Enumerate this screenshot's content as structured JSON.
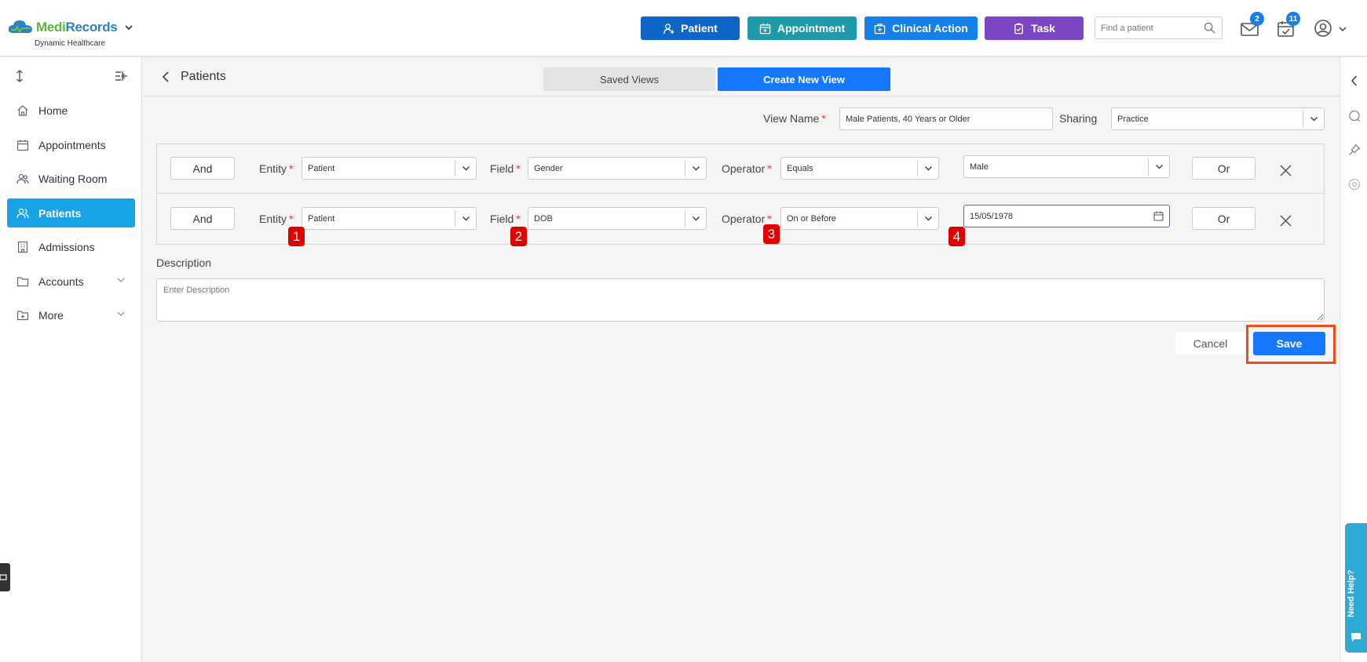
{
  "brand": {
    "name_part1": "Medi",
    "name_part2": "Records",
    "subtitle": "Dynamic Healthcare"
  },
  "header": {
    "buttons": [
      {
        "label": "Patient",
        "color": "#0e65c8"
      },
      {
        "label": "Appointment",
        "color": "#1e9aaa"
      },
      {
        "label": "Clinical Action",
        "color": "#1480e8"
      },
      {
        "label": "Task",
        "color": "#7b45c4"
      }
    ],
    "search_placeholder": "Find a patient",
    "mail_badge": "2",
    "calendar_badge": "11"
  },
  "sidebar": {
    "items": [
      {
        "label": "Home",
        "icon": "home-icon"
      },
      {
        "label": "Appointments",
        "icon": "calendar-icon"
      },
      {
        "label": "Waiting Room",
        "icon": "people-icon"
      },
      {
        "label": "Patients",
        "icon": "patients-icon",
        "active": true
      },
      {
        "label": "Admissions",
        "icon": "building-icon"
      },
      {
        "label": "Accounts",
        "icon": "folder-icon"
      },
      {
        "label": "More",
        "icon": "folder-add-icon"
      }
    ]
  },
  "page": {
    "breadcrumb": "Patients",
    "tabs": [
      "Saved Views",
      "Create New View"
    ]
  },
  "form": {
    "view_name_label": "View Name",
    "view_name_value": "Male Patients, 40 Years or Older",
    "sharing_label": "Sharing",
    "sharing_value": "Practice",
    "labels": {
      "entity": "Entity",
      "field": "Field",
      "operator": "Operator",
      "and": "And",
      "or": "Or"
    },
    "filters": [
      {
        "entity": "Patient",
        "field": "Gender",
        "operator": "Equals",
        "value": "Male"
      },
      {
        "entity": "Patient",
        "field": "DOB",
        "operator": "On or Before",
        "value": "15/05/1978"
      }
    ],
    "markers": [
      "1",
      "2",
      "3",
      "4"
    ],
    "description_label": "Description",
    "description_placeholder": "Enter Description",
    "cancel_label": "Cancel",
    "save_label": "Save"
  },
  "help_tab": "Need Help?",
  "colors": {
    "accent": "#1677ff",
    "active_nav": "#16a3e8",
    "marker": "#e00000",
    "highlight": "#f04d1a"
  }
}
